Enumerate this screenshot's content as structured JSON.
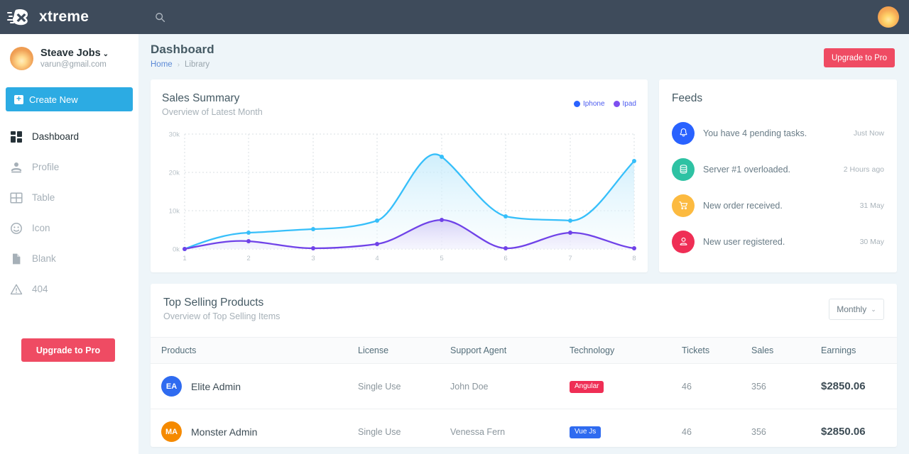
{
  "app": {
    "brand": "xtreme",
    "logo_icon": "xtreme-logo-icon",
    "search_icon": "search-icon",
    "avatar_icon": "user-avatar"
  },
  "sidebar": {
    "user": {
      "name": "Steave Jobs",
      "email": "varun@gmail.com",
      "caret": "⌄"
    },
    "create_new": {
      "label": "Create New",
      "plus": "+"
    },
    "items": [
      {
        "label": "Dashboard",
        "icon": "dashboard-icon",
        "active": true
      },
      {
        "label": "Profile",
        "icon": "profile-icon",
        "active": false
      },
      {
        "label": "Table",
        "icon": "table-icon",
        "active": false
      },
      {
        "label": "Icon",
        "icon": "smiley-icon",
        "active": false
      },
      {
        "label": "Blank",
        "icon": "file-icon",
        "active": false
      },
      {
        "label": "404",
        "icon": "warning-triangle-icon",
        "active": false
      }
    ],
    "upgrade_label": "Upgrade to Pro"
  },
  "header": {
    "title": "Dashboard",
    "breadcrumb": {
      "home": "Home",
      "separator": "›",
      "current": "Library"
    },
    "upgrade_label": "Upgrade to Pro"
  },
  "sales_card": {
    "title": "Sales Summary",
    "subtitle": "Overview of Latest Month"
  },
  "chart_data": {
    "type": "area",
    "title": "Sales Summary",
    "subtitle": "Overview of Latest Month",
    "xlabel": "",
    "ylabel": "",
    "x": [
      1,
      2,
      3,
      4,
      5,
      6,
      7,
      8
    ],
    "xticklabels": [
      "1",
      "2",
      "3",
      "4",
      "5",
      "6",
      "7",
      "8"
    ],
    "yticks": [
      0,
      10000,
      20000,
      30000
    ],
    "yticklabels": [
      "0k",
      "10k",
      "20k",
      "30k"
    ],
    "ylim": [
      0,
      30000
    ],
    "grid": true,
    "legend_position": "top-right",
    "series": [
      {
        "name": "Iphone",
        "color": "#36bffa",
        "fill": "#e8f7fd",
        "legend_dot_color": "#2962ff",
        "values": [
          0,
          4200,
          5200,
          7400,
          24100,
          8500,
          7400,
          23000
        ]
      },
      {
        "name": "Ipad",
        "color": "#6f42e8",
        "fill": "#e6e3fa",
        "legend_dot_color": "#7d4ff0",
        "values": [
          0,
          2100,
          100,
          1300,
          7500,
          100,
          4200,
          100
        ]
      }
    ]
  },
  "feeds": {
    "title": "Feeds",
    "items": [
      {
        "icon": "bell-icon",
        "color": "#2962ff",
        "text": "You have 4 pending tasks.",
        "time": "Just Now"
      },
      {
        "icon": "database-icon",
        "color": "#2ec2a3",
        "text": "Server #1 overloaded.",
        "time": "2 Hours ago"
      },
      {
        "icon": "cart-icon",
        "color": "#fcba40",
        "text": "New order received.",
        "time": "31 May"
      },
      {
        "icon": "user-icon",
        "color": "#ef2e55",
        "text": "New user registered.",
        "time": "30 May"
      }
    ]
  },
  "top_products": {
    "title": "Top Selling Products",
    "subtitle": "Overview of Top Selling Items",
    "filter": {
      "label": "Monthly",
      "chevron": "⌄"
    },
    "columns": [
      "Products",
      "License",
      "Support Agent",
      "Technology",
      "Tickets",
      "Sales",
      "Earnings"
    ],
    "rows": [
      {
        "initials": "EA",
        "avatar_color": "#2f6bf0",
        "product": "Elite Admin",
        "license": "Single Use",
        "agent": "John Doe",
        "tech": "Angular",
        "tech_color": "#ef2e55",
        "tickets": "46",
        "sales": "356",
        "earnings": "$2850.06"
      },
      {
        "initials": "MA",
        "avatar_color": "#f58a00",
        "product": "Monster Admin",
        "license": "Single Use",
        "agent": "Venessa Fern",
        "tech": "Vue Js",
        "tech_color": "#2f6bf0",
        "tickets": "46",
        "sales": "356",
        "earnings": "$2850.06"
      }
    ]
  }
}
